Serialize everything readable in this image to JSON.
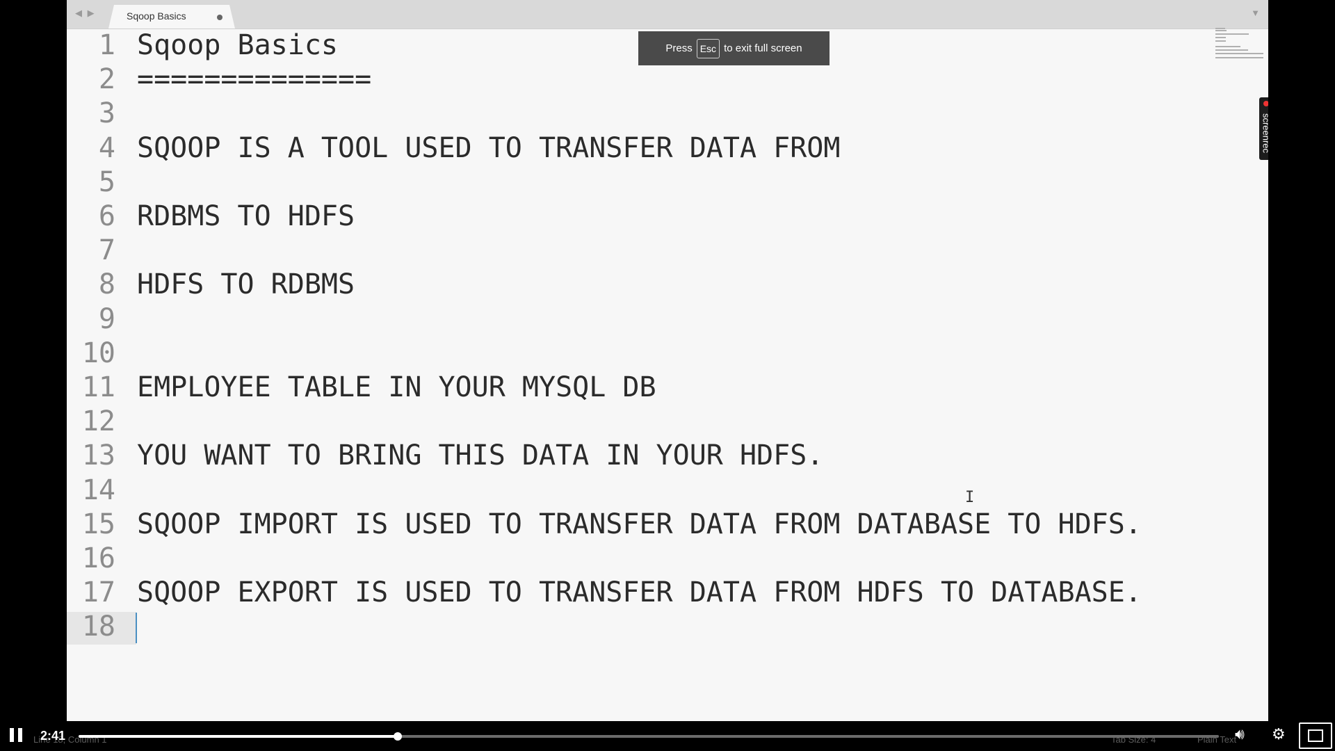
{
  "tab": {
    "title": "Sqoop Basics"
  },
  "editor": {
    "lines": [
      {
        "n": "1",
        "text": "Sqoop Basics"
      },
      {
        "n": "2",
        "text": "=============="
      },
      {
        "n": "3",
        "text": ""
      },
      {
        "n": "4",
        "text": "SQOOP IS A TOOL USED TO TRANSFER DATA FROM"
      },
      {
        "n": "5",
        "text": ""
      },
      {
        "n": "6",
        "text": "RDBMS TO HDFS"
      },
      {
        "n": "7",
        "text": ""
      },
      {
        "n": "8",
        "text": "HDFS TO RDBMS"
      },
      {
        "n": "9",
        "text": ""
      },
      {
        "n": "10",
        "text": ""
      },
      {
        "n": "11",
        "text": "EMPLOYEE TABLE IN YOUR MYSQL DB"
      },
      {
        "n": "12",
        "text": ""
      },
      {
        "n": "13",
        "text": "YOU WANT TO BRING THIS DATA IN YOUR HDFS."
      },
      {
        "n": "14",
        "text": ""
      },
      {
        "n": "15",
        "text": "SQOOP IMPORT IS USED TO TRANSFER DATA FROM DATABASE TO HDFS."
      },
      {
        "n": "16",
        "text": ""
      },
      {
        "n": "17",
        "text": "SQOOP EXPORT IS USED TO TRANSFER DATA FROM HDFS TO DATABASE."
      },
      {
        "n": "18",
        "text": ""
      }
    ],
    "current_line": 18
  },
  "toast": {
    "prefix": "Press",
    "key": "Esc",
    "suffix": "to exit full screen"
  },
  "badge": {
    "text": "screenrec"
  },
  "status": {
    "position": "Line 18, Column 1",
    "tab_size": "Tab Size: 4",
    "syntax": "Plain Text"
  },
  "player": {
    "time": "2:41",
    "progress_fraction": 0.28
  },
  "icons": {
    "nav": "tab-nav-arrows-icon",
    "overflow": "tab-overflow-icon",
    "pause": "pause-icon",
    "volume": "volume-icon",
    "settings": "gear-icon",
    "fullscreen": "exit-fullscreen-icon"
  }
}
